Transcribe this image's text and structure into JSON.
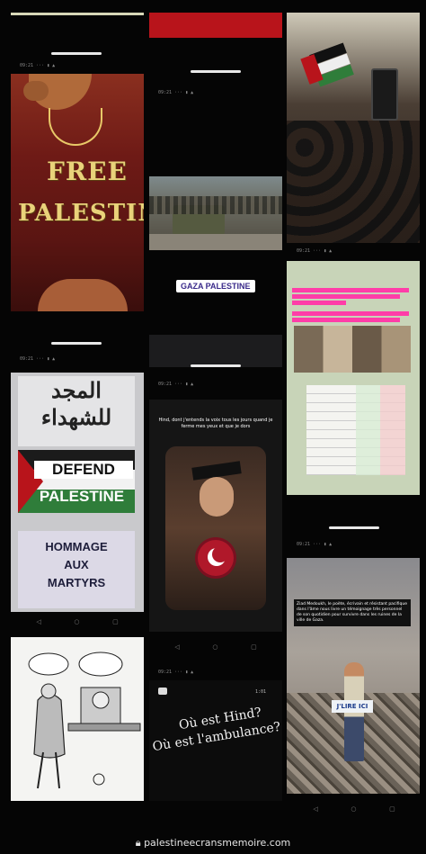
{
  "tiles": {
    "free_palestine": {
      "line1": "FREE",
      "line2": "PALESTIN"
    },
    "gaza_tag": "GAZA PALESTINE",
    "poster": {
      "arabic1": "المجد",
      "arabic2": "للشهداء",
      "defend": "DEFEND",
      "palestine": "PALESTINE",
      "hommage1": "HOMMAGE",
      "hommage2": "AUX",
      "hommage3": "MARTYRS"
    },
    "hind": {
      "caption": "Hind, dont j'entends la voix tous les jours quand je ferme mes yeux et que je dors"
    },
    "ambulance": {
      "line1": "Où est Hind?",
      "line2": "Où est l'ambulance?"
    },
    "gaza_caption": {
      "text": "Ziad Medoukh, le poète, écrivain et résistant pacifique dans l'âme nous livre un témoignage très personnel de son quotidien pour survivre dans les ruines de la ville de Gaza."
    },
    "sign": "J'LIRE ICI"
  },
  "footer": {
    "text": "palestineecransmemoire.com"
  },
  "colors": {
    "pink": "#ff3da8",
    "maroon": "#6e1a16",
    "red": "#b8141b",
    "green": "#2f7d3a"
  }
}
